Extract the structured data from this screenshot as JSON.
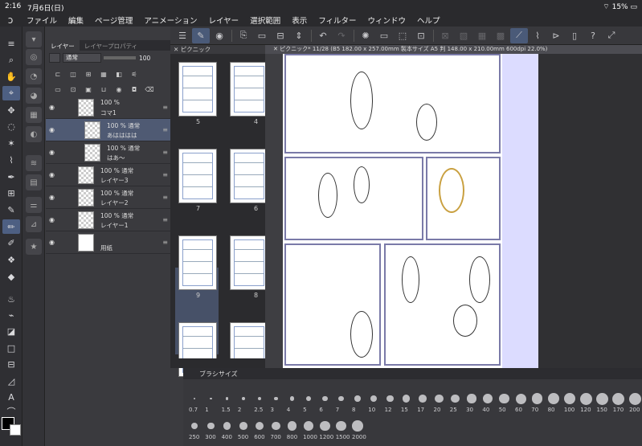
{
  "statusbar": {
    "time": "2:16",
    "date": "7月6日(日)",
    "battery": "15%"
  },
  "menubar": {
    "items": [
      "ファイル",
      "編集",
      "ページ管理",
      "アニメーション",
      "レイヤー",
      "選択範囲",
      "表示",
      "フィルター",
      "ウィンドウ",
      "ヘルプ"
    ]
  },
  "layer_panel": {
    "tabs": [
      "レイヤー",
      "レイヤープロパティ"
    ],
    "blend_mode": "通常",
    "opacity": "100",
    "layers": [
      {
        "name": "コマ1",
        "pct": "100 %",
        "indent": 0,
        "kind": "folder"
      },
      {
        "name": "あはははは",
        "pct": "100 % 通常",
        "indent": 1,
        "kind": "text",
        "selected": true
      },
      {
        "name": "はあ〜",
        "pct": "100 % 通常",
        "indent": 1,
        "kind": "text"
      },
      {
        "name": "レイヤー3",
        "pct": "100 % 通常",
        "indent": 0,
        "kind": "raster"
      },
      {
        "name": "レイヤー2",
        "pct": "100 % 通常",
        "indent": 0,
        "kind": "raster"
      },
      {
        "name": "レイヤー1",
        "pct": "100 % 通常",
        "indent": 0,
        "kind": "raster"
      },
      {
        "name": "用紙",
        "pct": "",
        "indent": 0,
        "kind": "paper"
      }
    ]
  },
  "page_manager": {
    "tab": "ピクニック",
    "pages": [
      {
        "num": "5",
        "col": 0,
        "row": 0
      },
      {
        "num": "4",
        "col": 1,
        "row": 0
      },
      {
        "num": "7",
        "col": 0,
        "row": 1
      },
      {
        "num": "6",
        "col": 1,
        "row": 1
      },
      {
        "num": "9",
        "col": 0,
        "row": 2
      },
      {
        "num": "8",
        "col": 1,
        "row": 2
      },
      {
        "num": "11*",
        "col": 0,
        "row": 3
      },
      {
        "num": "10",
        "col": 1,
        "row": 3
      }
    ]
  },
  "canvas": {
    "tab": "ピクニック* 11/28 (B5 182.00 x 257.00mm 製本サイズ A5 判 148.00 x 210.00mm 600dpi 22.0%)"
  },
  "brush_panel": {
    "title": "ブラシサイズ",
    "row1": [
      "0.7",
      "1",
      "1.5",
      "2",
      "2.5",
      "3",
      "4",
      "5",
      "6",
      "7",
      "8",
      "10",
      "12",
      "15",
      "17",
      "20",
      "25",
      "30",
      "40",
      "50",
      "60",
      "70",
      "80",
      "100",
      "120",
      "150",
      "170",
      "200"
    ],
    "row2": [
      "250",
      "300",
      "400",
      "500",
      "600",
      "700",
      "800",
      "1000",
      "1200",
      "1500",
      "2000"
    ]
  },
  "colors": {
    "accent": "#4d5f82",
    "panel": "#3a3a3e",
    "canvas_bg": "#3e3e42"
  }
}
